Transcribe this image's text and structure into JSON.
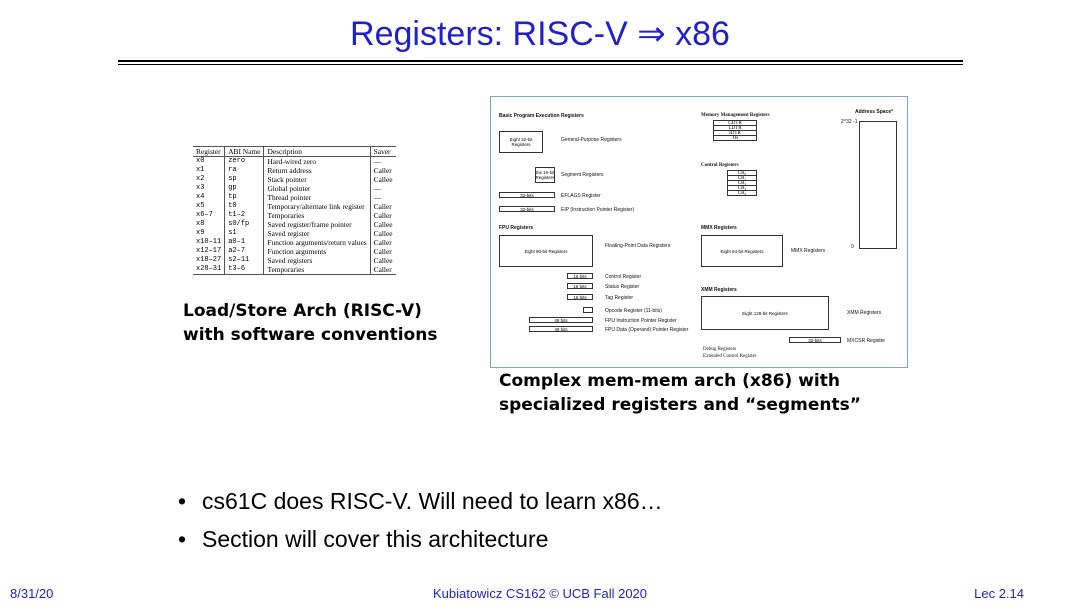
{
  "slide": {
    "title": "Registers: RISC-V ⇒ x86"
  },
  "riscv_table": {
    "headers": [
      "Register",
      "ABI Name",
      "Description",
      "Saver"
    ],
    "rows": [
      [
        "x0",
        "zero",
        "Hard-wired zero",
        "—"
      ],
      [
        "x1",
        "ra",
        "Return address",
        "Caller"
      ],
      [
        "x2",
        "sp",
        "Stack pointer",
        "Callee"
      ],
      [
        "x3",
        "gp",
        "Global pointer",
        "—"
      ],
      [
        "x4",
        "tp",
        "Thread pointer",
        "—"
      ],
      [
        "x5",
        "t0",
        "Temporary/alternate link register",
        "Caller"
      ],
      [
        "x6–7",
        "t1–2",
        "Temporaries",
        "Caller"
      ],
      [
        "x8",
        "s0/fp",
        "Saved register/frame pointer",
        "Callee"
      ],
      [
        "x9",
        "s1",
        "Saved register",
        "Callee"
      ],
      [
        "x10–11",
        "a0–1",
        "Function arguments/return values",
        "Caller"
      ],
      [
        "x12–17",
        "a2–7",
        "Function arguments",
        "Caller"
      ],
      [
        "x18–27",
        "s2–11",
        "Saved registers",
        "Callee"
      ],
      [
        "x28–31",
        "t3–6",
        "Temporaries",
        "Caller"
      ]
    ]
  },
  "captions": {
    "riscv_line1": "Load/Store Arch (RISC-V)",
    "riscv_line2": "with software conventions",
    "x86_line1": "Complex mem-mem arch (x86) with",
    "x86_line2": "specialized registers and “segments”"
  },
  "x86_diagram": {
    "basic_title": "Basic Program Execution Registers",
    "gpr_box": "Eight 32-bit Registers",
    "gpr_label": "General-Purpose Registers",
    "seg_box": "Six 16-bit Registers",
    "seg_label": "Segment Registers",
    "eflags_box": "32-bits",
    "eflags_label": "EFLAGS Register",
    "eip_box": "32-bits",
    "eip_label": "EIP (Instruction Pointer Register)",
    "mem_title": "Memory Management Registers",
    "mem_regs": [
      "GDTR",
      "LDTR",
      "IDTR",
      "TR"
    ],
    "ctrl_title": "Control Registers",
    "ctrl_regs": [
      "CR₀",
      "CR₁",
      "CR₂",
      "CR₃",
      "CR₄"
    ],
    "addr_title": "Address Space*",
    "addr_top": "2^32 -1",
    "addr_bottom": "0",
    "fpu_title": "FPU Registers",
    "fpu_box": "Eight 80-bit Registers",
    "fpu_label": "Floating-Point Data Registers",
    "fpu_16_box": "16 bits",
    "fpu_ctrl": "Control Register",
    "fpu_status": "Status Register",
    "fpu_tag": "Tag Register",
    "opcode_label": "Opcode Register (11-bits)",
    "fpu_48_box": "48 bits",
    "fpu_ip_label": "FPU Instruction Pointer Register",
    "fpu_dp_label": "FPU Data (Operand) Pointer Register",
    "mmx_title": "MMX Registers",
    "mmx_box": "Eight 64-bit Registers",
    "mmx_label": "MMX Registers",
    "xmm_title": "XMM Registers",
    "xmm_box": "Eight 128-bit Registers",
    "xmm_label": "XMM Registers",
    "mxcsr_box": "32-bits",
    "mxcsr_label": "MXCSR Register",
    "debug_label": "Debug Registers",
    "ext_ctrl_label": "Extended Control Register"
  },
  "bullets": [
    "cs61C does RISC-V.  Will need to learn x86…",
    "Section will cover this architecture"
  ],
  "footer": {
    "date": "8/31/20",
    "course": "Kubiatowicz CS162 © UCB Fall 2020",
    "lecture": "Lec 2.14"
  }
}
